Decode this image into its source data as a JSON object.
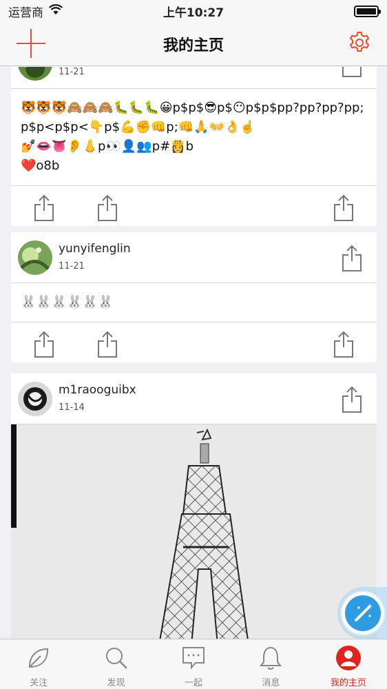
{
  "status_bar": {
    "carrier": "运营商",
    "time": "上午10:27"
  },
  "nav": {
    "title": "我的主页"
  },
  "posts": [
    {
      "username": "",
      "date": "11-21",
      "body_line1": "🐯🐯🐯🙈🙈🙈🐛🐛🐛😀p$p$😎p$😶p$p$pp?pp?pp?pp;p$p<p$p<👇p$💪✊👊p;👊🙏👐👌☝️",
      "body_line2": "💅👄👅👂👃p👀👤👥p#👸b",
      "body_line3": "❤️o8b"
    },
    {
      "username": "yunyifenglin",
      "date": "11-21",
      "body_line1": "🐰🐰🐰🐰🐰🐰"
    },
    {
      "username": "m1raooguibx",
      "date": "11-14"
    }
  ],
  "tabs": [
    {
      "label": "关注"
    },
    {
      "label": "发现"
    },
    {
      "label": "一起"
    },
    {
      "label": "消息"
    },
    {
      "label": "我的主页"
    }
  ],
  "colors": {
    "accent": "#f04a2b",
    "tab_active": "#e0231d",
    "fab": "#2f9be0"
  }
}
